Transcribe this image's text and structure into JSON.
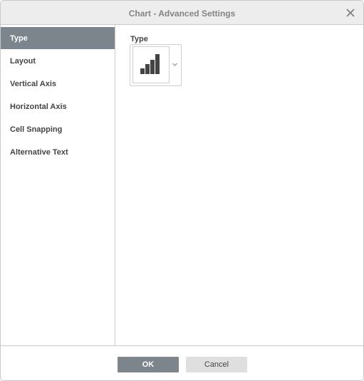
{
  "dialog": {
    "title": "Chart - Advanced Settings",
    "close_icon": "close-icon"
  },
  "sidebar": {
    "items": [
      {
        "label": "Type",
        "active": true
      },
      {
        "label": "Layout",
        "active": false
      },
      {
        "label": "Vertical Axis",
        "active": false
      },
      {
        "label": "Horizontal Axis",
        "active": false
      },
      {
        "label": "Cell Snapping",
        "active": false
      },
      {
        "label": "Alternative Text",
        "active": false
      }
    ]
  },
  "type_section": {
    "label": "Type",
    "selected_icon": "column-chart-icon",
    "dropdown_icon": "chevron-down-icon"
  },
  "footer": {
    "ok_label": "OK",
    "cancel_label": "Cancel"
  },
  "colors": {
    "accent": "#7d858c",
    "header_bg": "#ededed",
    "cancel_bg": "#dfdfdf",
    "icon_fill": "#444444"
  }
}
